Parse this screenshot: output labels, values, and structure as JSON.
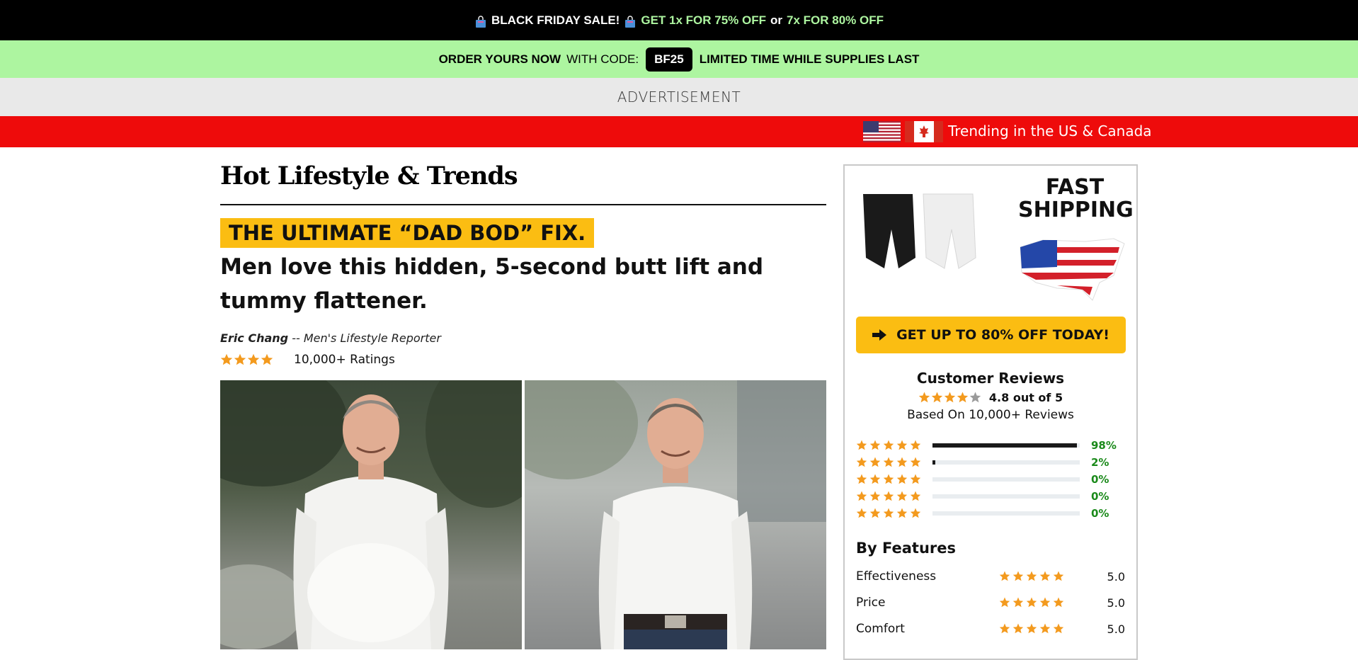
{
  "promo": {
    "black_friday": "BLACK FRIDAY SALE!",
    "offer1": "GET 1x FOR 75% OFF",
    "or": "or",
    "offer2": "7x FOR 80% OFF"
  },
  "code_bar": {
    "order_now": "ORDER YOURS NOW",
    "with_code": "WITH CODE:",
    "code": "BF25",
    "limited": "LIMITED TIME WHILE SUPPLIES LAST"
  },
  "advertisement": "ADVERTISEMENT",
  "trending": "Trending in the US & Canada",
  "article": {
    "site_title": "Hot Lifestyle & Trends",
    "highlight": "THE ULTIMATE “DAD BOD” FIX.",
    "subhead": "Men love this hidden, 5-second butt lift and tummy flattener.",
    "author": "Eric Chang",
    "author_role": "-- Men's Lifestyle Reporter",
    "ratings": "10,000+ Ratings",
    "stars": 4.5
  },
  "sidebar": {
    "fast_shipping": "FAST SHIPPING",
    "cta": "GET UP TO 80% OFF TODAY!",
    "reviews_title": "Customer Reviews",
    "score": "4.8 out of 5",
    "based_on": "Based On 10,000+ Reviews",
    "distribution": [
      {
        "pct": "98%",
        "fill": 0.98
      },
      {
        "pct": "2%",
        "fill": 0.02
      },
      {
        "pct": "0%",
        "fill": 0
      },
      {
        "pct": "0%",
        "fill": 0
      },
      {
        "pct": "0%",
        "fill": 0
      }
    ],
    "features_title": "By Features",
    "features": [
      {
        "name": "Effectiveness",
        "value": "5.0"
      },
      {
        "name": "Price",
        "value": "5.0"
      },
      {
        "name": "Comfort",
        "value": "5.0"
      }
    ]
  },
  "colors": {
    "accent_yellow": "#fbbd12",
    "promo_green": "#adf5a0",
    "trend_red": "#ee0b0b",
    "star_orange": "#f39a1e",
    "pct_green": "#1b8a1b"
  }
}
